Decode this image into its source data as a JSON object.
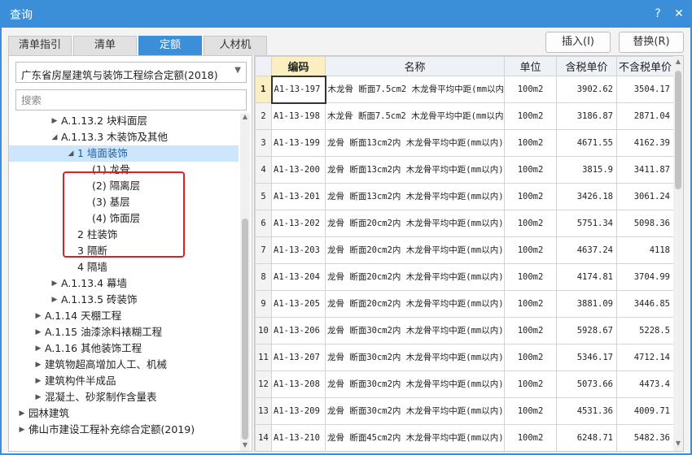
{
  "window": {
    "title": "查询",
    "help_glyph": "?",
    "close_glyph": "✕"
  },
  "tabs": [
    {
      "label": "清单指引"
    },
    {
      "label": "清单"
    },
    {
      "label": "定额"
    },
    {
      "label": "人材机"
    }
  ],
  "active_tab": "定额",
  "buttons": {
    "insert": "插入(I)",
    "replace": "替换(R)"
  },
  "library_select": {
    "value": "广东省房屋建筑与装饰工程综合定额(2018)"
  },
  "search": {
    "placeholder": "搜索",
    "value": ""
  },
  "tree": [
    {
      "label": "A.1.13.2 块料面层",
      "toggle": "▶",
      "level": 2
    },
    {
      "label": "A.1.13.3 木装饰及其他",
      "toggle": "◢",
      "level": 2
    },
    {
      "label": "1 墙面装饰",
      "toggle": "◢",
      "level": 3,
      "selected": true
    },
    {
      "label": "(1) 龙骨",
      "toggle": "",
      "level": 4
    },
    {
      "label": "(2) 隔离层",
      "toggle": "",
      "level": 4
    },
    {
      "label": "(3) 基层",
      "toggle": "",
      "level": 4
    },
    {
      "label": "(4) 饰面层",
      "toggle": "",
      "level": 4
    },
    {
      "label": "2 柱装饰",
      "toggle": "",
      "level": 3
    },
    {
      "label": "3 隔断",
      "toggle": "",
      "level": 3
    },
    {
      "label": "4 隔墙",
      "toggle": "",
      "level": 3
    },
    {
      "label": "A.1.13.4 幕墙",
      "toggle": "▶",
      "level": 2
    },
    {
      "label": "A.1.13.5 砖装饰",
      "toggle": "▶",
      "level": 2
    },
    {
      "label": "A.1.14 天棚工程",
      "toggle": "▶",
      "level": 1
    },
    {
      "label": "A.1.15 油漆涂料裱糊工程",
      "toggle": "▶",
      "level": 1
    },
    {
      "label": "A.1.16 其他装饰工程",
      "toggle": "▶",
      "level": 1
    },
    {
      "label": "建筑物超高增加人工、机械",
      "toggle": "▶",
      "level": 1
    },
    {
      "label": "建筑构件半成品",
      "toggle": "▶",
      "level": 1
    },
    {
      "label": "混凝土、砂浆制作含量表",
      "toggle": "▶",
      "level": 1
    },
    {
      "label": "园林建筑",
      "toggle": "▶",
      "level": 0
    },
    {
      "label": "佛山市建设工程补充综合定额(2019)",
      "toggle": "▶",
      "level": 0
    }
  ],
  "grid": {
    "headers": {
      "rownum": "",
      "code": "编码",
      "name": "名称",
      "unit": "单位",
      "price_tax": "含税单价",
      "price_notax": "不含税单价"
    },
    "rows": [
      {
        "n": "1",
        "code": "A1-13-197",
        "name": "木龙骨 断面7.5cm2 木龙骨平均中距(mm以内) 300",
        "unit": "100m2",
        "tax": "3902.62",
        "notax": "3504.17"
      },
      {
        "n": "2",
        "code": "A1-13-198",
        "name": "木龙骨 断面7.5cm2 木龙骨平均中距(mm以内) 400",
        "unit": "100m2",
        "tax": "3186.87",
        "notax": "2871.04"
      },
      {
        "n": "3",
        "code": "A1-13-199",
        "name": "龙骨 断面13cm2内 木龙骨平均中距(mm以内) 300",
        "unit": "100m2",
        "tax": "4671.55",
        "notax": "4162.39"
      },
      {
        "n": "4",
        "code": "A1-13-200",
        "name": "龙骨 断面13cm2内 木龙骨平均中距(mm以内) 400",
        "unit": "100m2",
        "tax": "3815.9",
        "notax": "3411.87"
      },
      {
        "n": "5",
        "code": "A1-13-201",
        "name": "龙骨 断面13cm2内 木龙骨平均中距(mm以内) 450",
        "unit": "100m2",
        "tax": "3426.18",
        "notax": "3061.24"
      },
      {
        "n": "6",
        "code": "A1-13-202",
        "name": "龙骨 断面20cm2内 木龙骨平均中距(mm以内) 300",
        "unit": "100m2",
        "tax": "5751.34",
        "notax": "5098.36"
      },
      {
        "n": "7",
        "code": "A1-13-203",
        "name": "龙骨 断面20cm2内 木龙骨平均中距(mm以内) 400",
        "unit": "100m2",
        "tax": "4637.24",
        "notax": "4118"
      },
      {
        "n": "8",
        "code": "A1-13-204",
        "name": "龙骨 断面20cm2内 木龙骨平均中距(mm以内) 450",
        "unit": "100m2",
        "tax": "4174.81",
        "notax": "3704.99"
      },
      {
        "n": "9",
        "code": "A1-13-205",
        "name": "龙骨 断面20cm2内 木龙骨平均中距(mm以内) 500",
        "unit": "100m2",
        "tax": "3881.09",
        "notax": "3446.85"
      },
      {
        "n": "10",
        "code": "A1-13-206",
        "name": "龙骨 断面30cm2内 木龙骨平均中距(mm以内) 400",
        "unit": "100m2",
        "tax": "5928.67",
        "notax": "5228.5"
      },
      {
        "n": "11",
        "code": "A1-13-207",
        "name": "龙骨 断面30cm2内 木龙骨平均中距(mm以内) 450",
        "unit": "100m2",
        "tax": "5346.17",
        "notax": "4712.14"
      },
      {
        "n": "12",
        "code": "A1-13-208",
        "name": "龙骨 断面30cm2内 木龙骨平均中距(mm以内) 500",
        "unit": "100m2",
        "tax": "5073.66",
        "notax": "4473.4"
      },
      {
        "n": "13",
        "code": "A1-13-209",
        "name": "龙骨 断面30cm2内 木龙骨平均中距(mm以内) 550",
        "unit": "100m2",
        "tax": "4531.36",
        "notax": "4009.71"
      },
      {
        "n": "14",
        "code": "A1-13-210",
        "name": "龙骨 断面45cm2内 木龙骨平均中距(mm以内) 400",
        "unit": "100m2",
        "tax": "6248.71",
        "notax": "5482.36"
      }
    ]
  },
  "colors": {
    "accent": "#3b8fd9",
    "highlight_box": "#e02020",
    "selected_bg": "#cde6fb",
    "code_header_bg": "#fbeec0"
  }
}
